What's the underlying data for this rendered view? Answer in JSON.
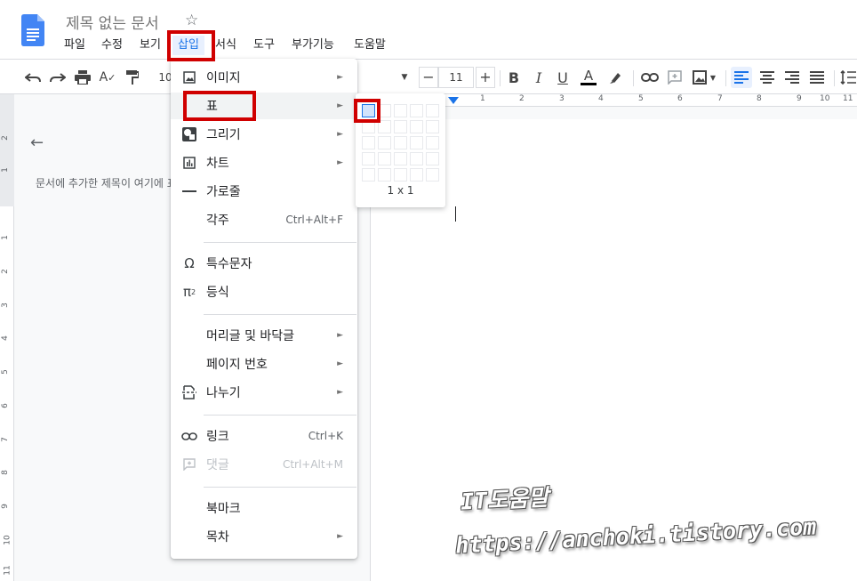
{
  "header": {
    "doc_title": "제목 없는 문서",
    "star_icon": "star-outline-icon",
    "logo_icon": "google-docs-logo"
  },
  "menubar": {
    "items": [
      "파일",
      "수정",
      "보기",
      "삽입",
      "서식",
      "도구",
      "부가기능",
      "도움말"
    ],
    "active": "삽입"
  },
  "toolbar": {
    "zoom_partial": "10",
    "font_size": "11",
    "minus": "−",
    "plus": "+",
    "bold": "B",
    "italic": "I",
    "underline": "U",
    "text_color": "A",
    "accent_color": "#1a73e8"
  },
  "outline": {
    "hint": "문서에 추가한 제목이 여기에 표시됩니다."
  },
  "vruler": {
    "numbers": [
      "2",
      "1",
      "1",
      "2",
      "3",
      "4",
      "5",
      "6",
      "7",
      "8",
      "9",
      "10",
      "11"
    ]
  },
  "hruler": {
    "numbers": [
      "1",
      "2",
      "3",
      "4",
      "5",
      "6",
      "7",
      "8",
      "9",
      "10",
      "11"
    ]
  },
  "insert_menu": {
    "items": [
      {
        "label": "이미지",
        "icon": "image-icon",
        "submenu": true
      },
      {
        "label": "표",
        "icon": "",
        "submenu": true,
        "hover": true
      },
      {
        "label": "그리기",
        "icon": "drawing-icon",
        "submenu": true
      },
      {
        "label": "차트",
        "icon": "chart-icon",
        "submenu": true
      },
      {
        "label": "가로줄",
        "icon": "horizontal-line-icon",
        "submenu": false
      },
      {
        "label": "각주",
        "icon": "",
        "shortcut": "Ctrl+Alt+F"
      },
      {
        "label": "특수문자",
        "icon": "omega-icon"
      },
      {
        "label": "등식",
        "icon": "pi-squared-icon"
      },
      {
        "label": "머리글 및 바닥글",
        "icon": "",
        "submenu": true
      },
      {
        "label": "페이지 번호",
        "icon": "",
        "submenu": true
      },
      {
        "label": "나누기",
        "icon": "page-break-icon",
        "submenu": true
      },
      {
        "label": "링크",
        "icon": "link-icon",
        "shortcut": "Ctrl+K"
      },
      {
        "label": "댓글",
        "icon": "comment-add-icon",
        "shortcut": "Ctrl+Alt+M",
        "disabled": true
      },
      {
        "label": "북마크",
        "icon": ""
      },
      {
        "label": "목차",
        "icon": "",
        "submenu": true
      }
    ],
    "submenu_arrow": "►"
  },
  "table_submenu": {
    "grid_rows": 5,
    "grid_cols": 5,
    "selected_rows": 1,
    "selected_cols": 1,
    "size_label": "1 x 1"
  },
  "watermark": {
    "line1": "IT도움말",
    "line2": "https://anchoki.tistory.com"
  },
  "highlight_color": "#d00000"
}
